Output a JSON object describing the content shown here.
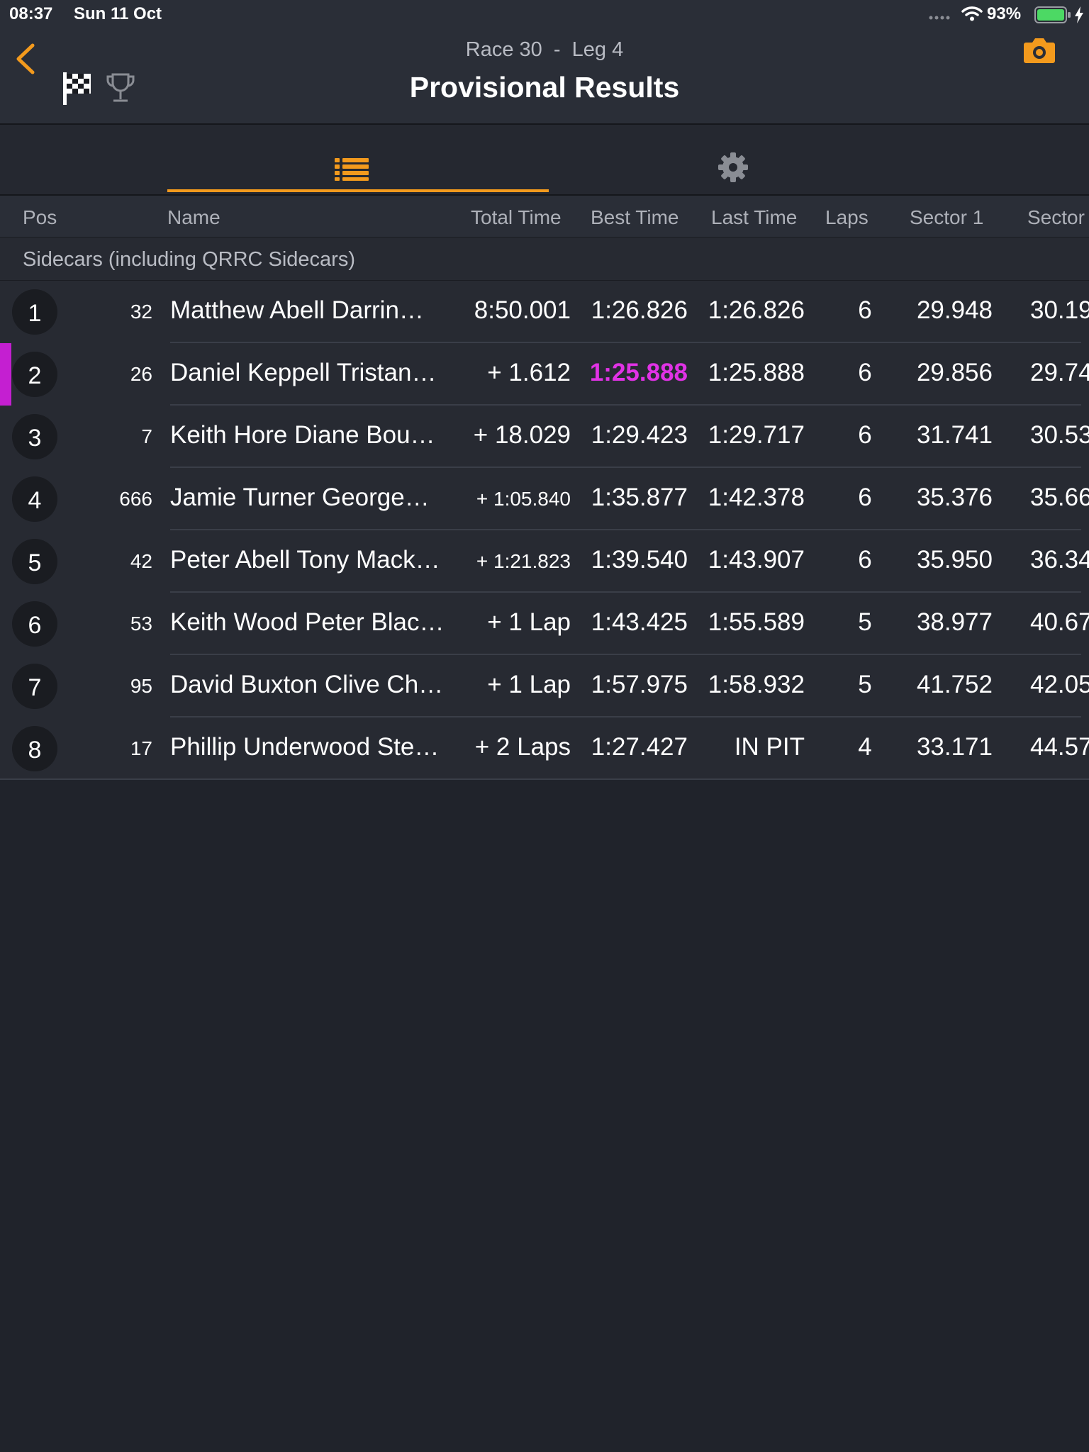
{
  "status_bar": {
    "time": "08:37",
    "date": "Sun 11 Oct",
    "battery": "93%",
    "icons": [
      "signal-dots-icon",
      "wifi-icon",
      "battery-icon",
      "charging-bolt-icon"
    ]
  },
  "header": {
    "subtitle": "Race 30  -  Leg 4",
    "title": "Provisional Results",
    "icons": [
      "back-chevron-icon",
      "checkered-flag-icon",
      "trophy-icon",
      "camera-icon"
    ],
    "accent_color": "#f39a1d"
  },
  "tabs": [
    {
      "icon": "list-icon",
      "selected": true
    },
    {
      "icon": "gear-icon",
      "selected": false
    }
  ],
  "columns": {
    "pos": "Pos",
    "name": "Name",
    "total_time": "Total Time",
    "best_time": "Best Time",
    "last_time": "Last Time",
    "laps": "Laps",
    "sector1": "Sector 1",
    "sector2": "Sector"
  },
  "group_label": "Sidecars (including QRRC Sidecars)",
  "rows": [
    {
      "pos": "1",
      "num": "32",
      "name": "Matthew Abell Darrin…",
      "total": "8:50.001",
      "best": "1:26.826",
      "last": "1:26.826",
      "laps": "6",
      "s1": "29.948",
      "s2": "30.19"
    },
    {
      "pos": "2",
      "num": "26",
      "name": "Daniel Keppell Tristan…",
      "total": "+ 1.612",
      "best": "1:25.888",
      "last": "1:25.888",
      "laps": "6",
      "s1": "29.856",
      "s2": "29.74"
    },
    {
      "pos": "3",
      "num": "7",
      "name": "Keith Hore Diane Bou…",
      "total": "+ 18.029",
      "best": "1:29.423",
      "last": "1:29.717",
      "laps": "6",
      "s1": "31.741",
      "s2": "30.53"
    },
    {
      "pos": "4",
      "num": "666",
      "name": "Jamie Turner George…",
      "total": "+ 1:05.840",
      "best": "1:35.877",
      "last": "1:42.378",
      "laps": "6",
      "s1": "35.376",
      "s2": "35.66"
    },
    {
      "pos": "5",
      "num": "42",
      "name": "Peter Abell Tony Mack…",
      "total": "+ 1:21.823",
      "best": "1:39.540",
      "last": "1:43.907",
      "laps": "6",
      "s1": "35.950",
      "s2": "36.34"
    },
    {
      "pos": "6",
      "num": "53",
      "name": "Keith Wood Peter Blac…",
      "total": "+ 1 Lap",
      "best": "1:43.425",
      "last": "1:55.589",
      "laps": "5",
      "s1": "38.977",
      "s2": "40.67"
    },
    {
      "pos": "7",
      "num": "95",
      "name": "David Buxton Clive Ch…",
      "total": "+ 1 Lap",
      "best": "1:57.975",
      "last": "1:58.932",
      "laps": "5",
      "s1": "41.752",
      "s2": "42.05"
    },
    {
      "pos": "8",
      "num": "17",
      "name": "Phillip Underwood Ste…",
      "total": "+ 2 Laps",
      "best": "1:27.427",
      "last": "IN PIT",
      "laps": "4",
      "s1": "33.171",
      "s2": "44.57"
    }
  ],
  "highlight_color": "#e132e6"
}
